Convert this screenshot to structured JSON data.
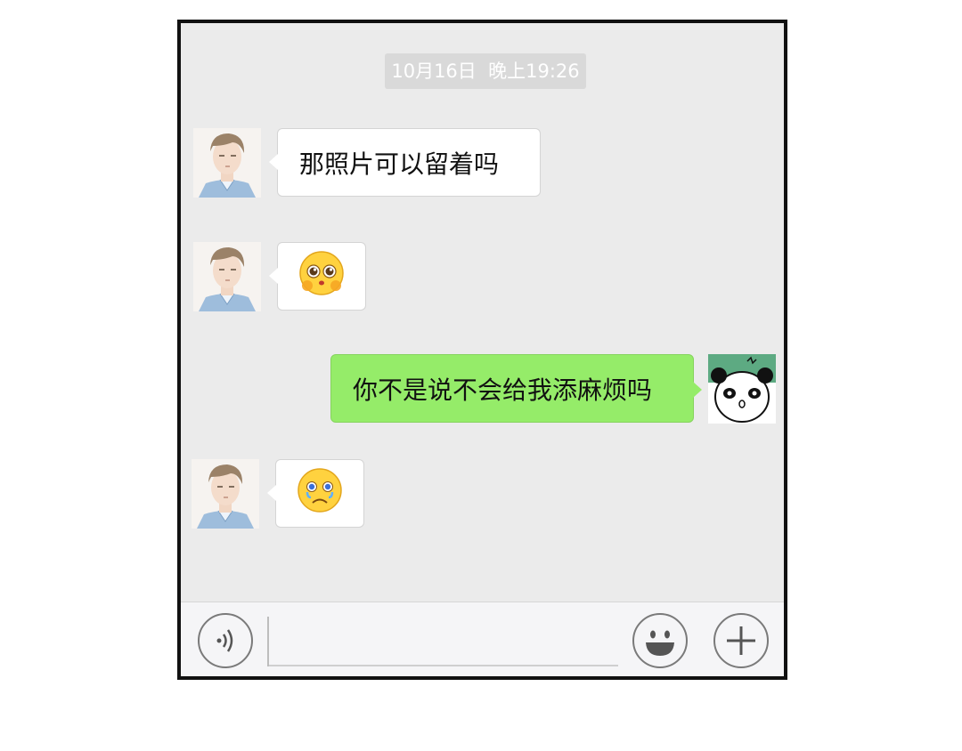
{
  "timestamp": "10月16日  晚上19:26",
  "messages": [
    {
      "side": "incoming",
      "type": "text",
      "text": "那照片可以留着吗"
    },
    {
      "side": "incoming",
      "type": "emoji",
      "emoji": "pleading-face"
    },
    {
      "side": "outgoing",
      "type": "text",
      "text": "你不是说不会给我添麻烦吗"
    },
    {
      "side": "incoming",
      "type": "emoji",
      "emoji": "crying-face"
    }
  ],
  "input_bar": {
    "text_value": "",
    "left_icon": "voice-icon",
    "emoji_icon": "emoji-face-icon",
    "plus_icon": "plus-icon"
  },
  "colors": {
    "chat_background": "#ebebeb",
    "outgoing_bubble": "#95ec69",
    "incoming_bubble": "#ffffff",
    "timestamp_background": "#d9d9d9"
  }
}
